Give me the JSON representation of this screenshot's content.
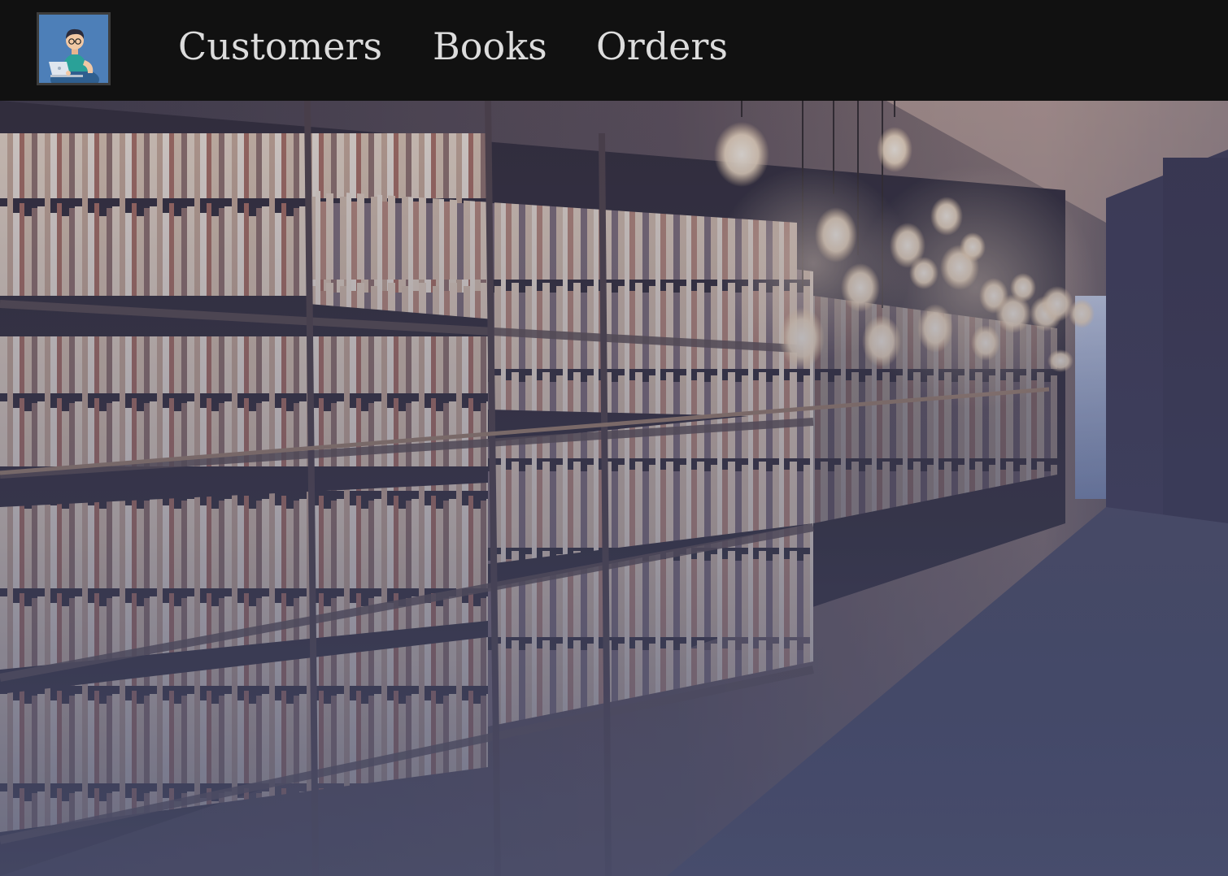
{
  "navbar": {
    "logo_icon": "librarian-avatar-icon",
    "links": [
      {
        "label": "Customers"
      },
      {
        "label": "Books"
      },
      {
        "label": "Orders"
      }
    ]
  },
  "hero": {
    "image": "library-bookshelves-with-hanging-bulbs-photo"
  },
  "colors": {
    "navbar_bg": "#111111",
    "nav_text": "#dcdcdc",
    "logo_bg": "#4d7fb8",
    "overlay_tint": "#4a5070"
  }
}
